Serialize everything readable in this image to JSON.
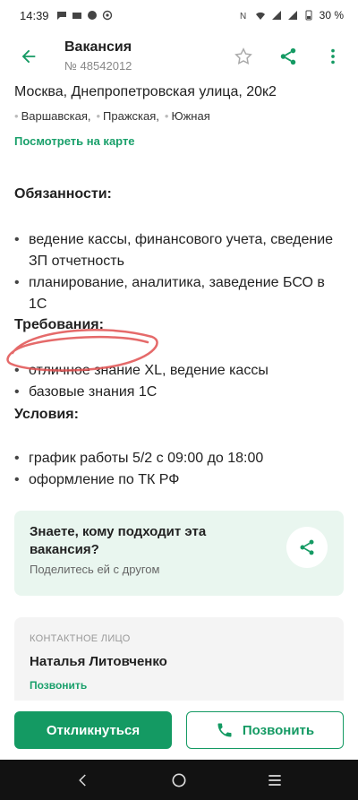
{
  "status": {
    "time": "14:39",
    "battery": "30 %"
  },
  "appbar": {
    "title": "Вакансия",
    "vacancy_number": "№ 48542012"
  },
  "location": {
    "address": "Москва, Днепропетровская улица, 20к2",
    "metro": [
      "Варшавская,",
      "Пражская,",
      "Южная"
    ],
    "map_link": "Посмотреть на карте"
  },
  "duties": {
    "title": "Обязанности:",
    "items": [
      "ведение кассы, финансового учета, сведение ЗП отчетность",
      "планирование, аналитика, заведение БСО в 1С"
    ]
  },
  "requirements": {
    "title": "Требования:",
    "items": [
      "отличное знание XL, ведение кассы",
      "базовые знания 1С"
    ]
  },
  "conditions": {
    "title": "Условия:",
    "items": [
      "график работы 5/2 с 09:00 до 18:00",
      "оформление по ТК РФ"
    ]
  },
  "share_card": {
    "heading": "Знаете, кому подходит эта вакансия?",
    "subtext": "Поделитесь ей с другом"
  },
  "contact": {
    "label": "КОНТАКТНОЕ ЛИЦО",
    "name": "Наталья Литовченко",
    "call_link": "Позвонить"
  },
  "actions": {
    "respond": "Откликнуться",
    "call": "Позвонить"
  },
  "colors": {
    "accent": "#149a63",
    "share_bg": "#e9f6ef",
    "scribble": "#e05050"
  }
}
